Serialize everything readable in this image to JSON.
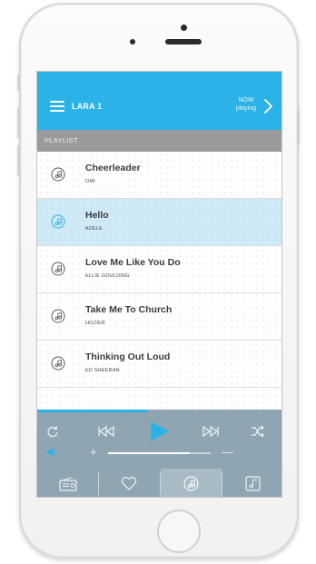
{
  "header": {
    "device_name": "LARA 1",
    "now_line1": "NOW",
    "now_line2": "playing"
  },
  "playlist": {
    "label": "PLAYLIST",
    "tracks": [
      {
        "title": "Cheerleader",
        "artist": "OMI",
        "active": false
      },
      {
        "title": "Hello",
        "artist": "ADELE",
        "active": true
      },
      {
        "title": "Love Me Like You Do",
        "artist": "ELLIE GOULDING",
        "active": false
      },
      {
        "title": "Take Me To Church",
        "artist": "HOZIER",
        "active": false
      },
      {
        "title": "Thinking Out Loud",
        "artist": "ED SHEERAN",
        "active": false
      }
    ]
  },
  "player": {
    "playback_progress": 0.45,
    "volume_level": 0.8,
    "plus_label": "+",
    "minus_label": "—"
  },
  "tabs": [
    {
      "icon": "radio-icon",
      "active": false
    },
    {
      "icon": "heart-icon",
      "active": false
    },
    {
      "icon": "music-note-icon",
      "active": true
    },
    {
      "icon": "music-library-icon",
      "active": false
    }
  ],
  "colors": {
    "accent": "#2bb3e8",
    "header_bar": "#9a9a9c",
    "selected_row": "#cfe9f6",
    "player_bg": "#8fa6b2"
  }
}
